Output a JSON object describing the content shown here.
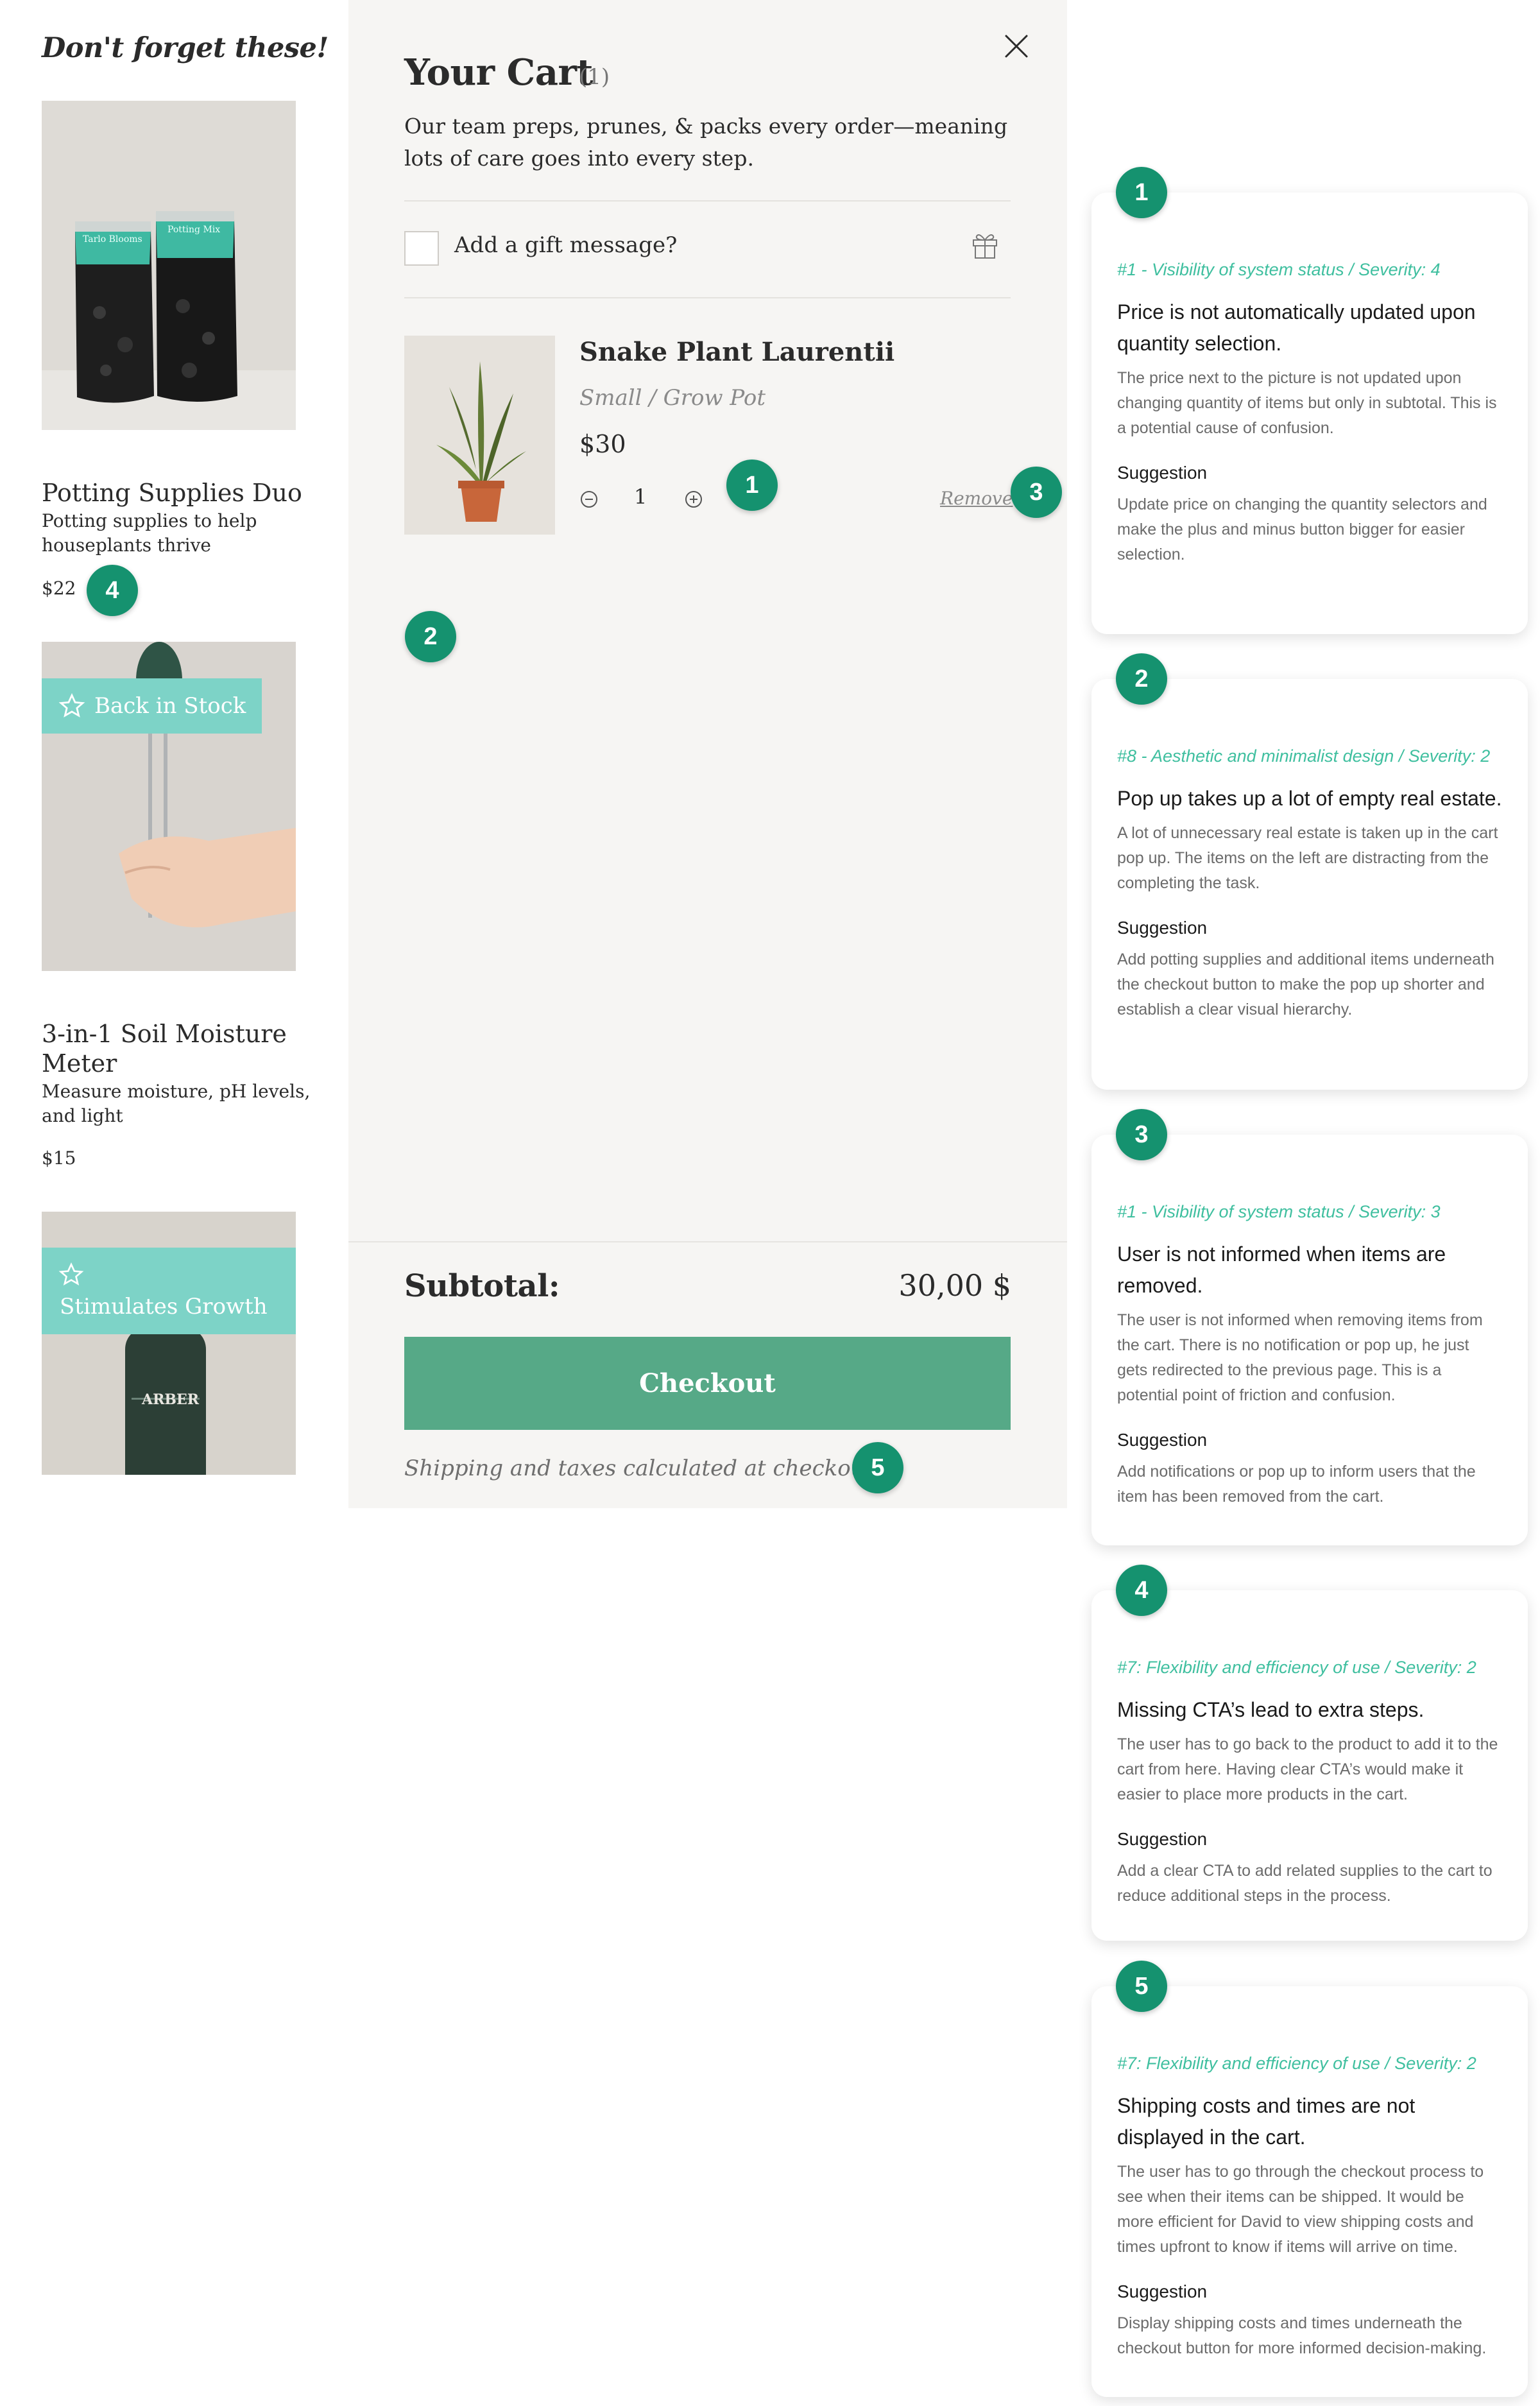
{
  "left": {
    "heading": "Don't forget these!",
    "products": [
      {
        "name": "Potting Supplies Duo",
        "description": "Potting supplies to help houseplants thrive",
        "price": "$22",
        "badge": ""
      },
      {
        "name": "3-in-1 Soil Moisture Meter",
        "description": "Measure moisture, pH levels, and light",
        "price": "$15",
        "badge": "Back in Stock"
      },
      {
        "name": "",
        "description": "",
        "price": "",
        "badge": "Stimulates Growth"
      }
    ],
    "bag_labels": [
      "Tarlo Blooms",
      "Potting Mix"
    ],
    "bottle_label": "ARBER"
  },
  "cart": {
    "title": "Your Cart",
    "count": "(1)",
    "intro": "Our team preps, prunes, & packs every order—meaning lots of care goes into every step.",
    "gift_label": "Add a gift message?",
    "item": {
      "name": "Snake Plant Laurentii",
      "variant": "Small / Grow Pot",
      "price": "$30",
      "quantity": "1",
      "remove_label": "Remove"
    },
    "subtotal_label": "Subtotal:",
    "subtotal_value": "30,00 $",
    "checkout_label": "Checkout",
    "shipping_note": "Shipping and taxes calculated at checkout."
  },
  "markers": [
    "1",
    "2",
    "3",
    "4",
    "5"
  ],
  "cards": [
    {
      "number": "1",
      "heading": "#1 - Visibility of system status / Severity: 4",
      "title": "Price is not automatically updated upon quantity selection.",
      "body": "The price next to the picture is not updated upon changing quantity of items but only in subtotal. This is a potential cause of confusion.",
      "suggestion_label": "Suggestion",
      "suggestion": "Update price on changing the quantity selectors and make the plus and minus button bigger for easier selection."
    },
    {
      "number": "2",
      "heading": "#8 - Aesthetic and minimalist design / Severity: 2",
      "title": "Pop up takes up a lot of empty real estate.",
      "body": "A lot of unnecessary real estate is taken up in the cart pop up. The items on the left are distracting from the completing the task.",
      "suggestion_label": "Suggestion",
      "suggestion": "Add potting supplies and additional items underneath the checkout button to make the pop up shorter and establish a clear visual hierarchy."
    },
    {
      "number": "3",
      "heading": "#1 - Visibility of system status / Severity: 3",
      "title": "User is not informed when items are removed.",
      "body": "The user is not informed when removing items from the cart. There is no notification or pop up, he just gets redirected to the previous page. This is a potential point of friction and confusion.",
      "suggestion_label": "Suggestion",
      "suggestion": "Add notifications or pop up to inform users that the item has been removed from the cart."
    },
    {
      "number": "4",
      "heading": "#7: Flexibility and efficiency of use / Severity: 2",
      "title": "Missing CTA’s lead to extra steps.",
      "body": "The user has to go back to the product to add it to the cart from here. Having clear CTA’s would make it easier to place more products in the cart.",
      "suggestion_label": "Suggestion",
      "suggestion": "Add a clear CTA to add related supplies to the cart to reduce additional steps in the process."
    },
    {
      "number": "5",
      "heading": "#7: Flexibility and efficiency of use / Severity: 2",
      "title": "Shipping costs and times are not displayed in the cart.",
      "body": "The user has to go through the checkout process to see when their items can be shipped. It would be more efficient for David to view shipping costs and times upfront to know if items will arrive on time.",
      "suggestion_label": "Suggestion",
      "suggestion": "Display shipping costs and times underneath the checkout button for more informed decision-making."
    }
  ],
  "colors": {
    "marker": "#15926f",
    "checkout": "#56a987",
    "badge": "#7dd3c7",
    "card_heading": "#3fbf9f",
    "cart_bg": "#f6f5f3"
  },
  "icons": [
    "close-icon",
    "gift-icon",
    "minus-circle-icon",
    "plus-circle-icon",
    "star-icon"
  ]
}
